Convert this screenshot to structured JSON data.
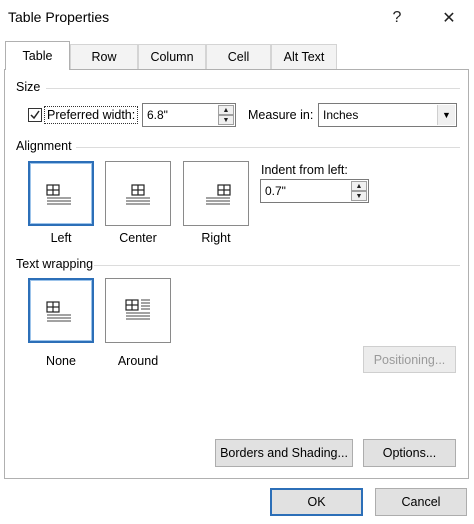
{
  "window": {
    "title": "Table Properties",
    "help": "?",
    "close": "✕"
  },
  "tabs": [
    {
      "label": "Table",
      "active": true
    },
    {
      "label": "Row"
    },
    {
      "label": "Column"
    },
    {
      "label": "Cell"
    },
    {
      "label": "Alt Text"
    }
  ],
  "size": {
    "section": "Size",
    "preferred_width_label": "Preferred width:",
    "preferred_width_checked": true,
    "preferred_width_value": "6.8\"",
    "measure_label": "Measure in:",
    "measure_value": "Inches"
  },
  "alignment": {
    "section": "Alignment",
    "options": [
      "Left",
      "Center",
      "Right"
    ],
    "selected": "Left",
    "indent_label": "Indent from left:",
    "indent_value": "0.7\""
  },
  "wrapping": {
    "section": "Text wrapping",
    "options": [
      "None",
      "Around"
    ],
    "selected": "None",
    "positioning_button": "Positioning..."
  },
  "buttons": {
    "borders": "Borders and Shading...",
    "options": "Options...",
    "ok": "OK",
    "cancel": "Cancel"
  },
  "colors": {
    "accent": "#2c6fb8",
    "button_face": "#e1e1e1"
  }
}
